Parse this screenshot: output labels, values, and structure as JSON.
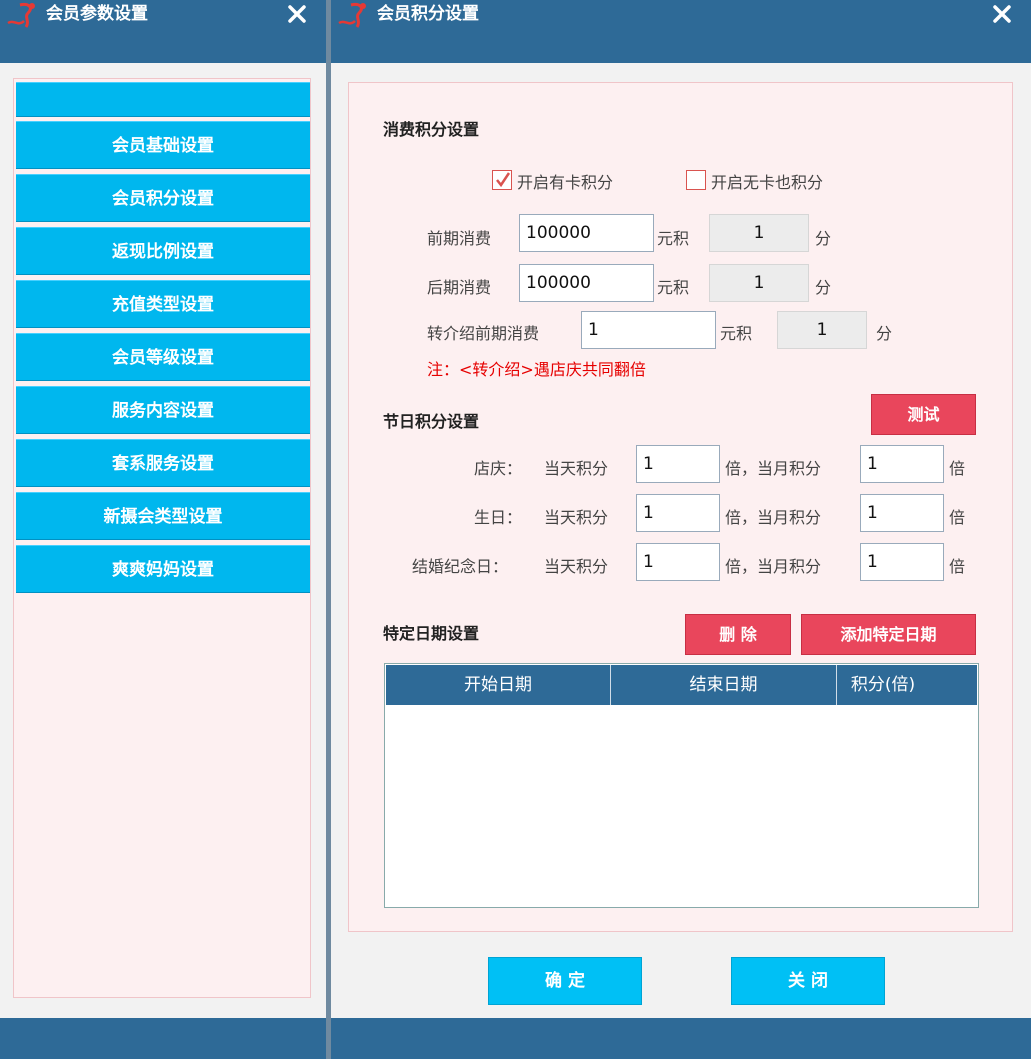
{
  "left_window": {
    "title": "会员参数设置",
    "nav_items": [
      {
        "label": ""
      },
      {
        "label": "会员基础设置"
      },
      {
        "label": "会员积分设置"
      },
      {
        "label": "返现比例设置"
      },
      {
        "label": "充值类型设置"
      },
      {
        "label": "会员等级设置"
      },
      {
        "label": "服务内容设置"
      },
      {
        "label": "套系服务设置"
      },
      {
        "label": "新摄会类型设置"
      },
      {
        "label": "爽爽妈妈设置"
      }
    ]
  },
  "right_window": {
    "title": "会员积分设置",
    "consume": {
      "section_title": "消费积分设置",
      "card_points_label": "开启有卡积分",
      "card_points_checked": true,
      "nocard_points_label": "开启无卡也积分",
      "nocard_points_checked": false,
      "early_label": "前期消费",
      "early_amount": "100000",
      "yuan_ji": "元积",
      "early_points": "1",
      "fen": "分",
      "late_label": "后期消费",
      "late_amount": "100000",
      "late_points": "1",
      "referral_label": "转介绍前期消费",
      "referral_amount": "1",
      "referral_points": "1",
      "note": "注：<转介绍>遇店庆共同翻倍"
    },
    "holiday": {
      "section_title": "节日积分设置",
      "test_button": "测试",
      "rows": [
        {
          "label": "店庆：",
          "day_label": "当天积分",
          "day_value": "1",
          "month_label": "倍，当月积分",
          "month_value": "1",
          "unit": "倍"
        },
        {
          "label": "生日：",
          "day_label": "当天积分",
          "day_value": "1",
          "month_label": "倍，当月积分",
          "month_value": "1",
          "unit": "倍"
        },
        {
          "label": "结婚纪念日：",
          "day_label": "当天积分",
          "day_value": "1",
          "month_label": "倍，当月积分",
          "month_value": "1",
          "unit": "倍"
        }
      ]
    },
    "special": {
      "section_title": "特定日期设置",
      "delete_button": "删 除",
      "add_button": "添加特定日期",
      "columns": [
        "开始日期",
        "结束日期",
        "积分(倍)"
      ]
    },
    "footer": {
      "confirm_button": "确 定",
      "close_button": "关 闭"
    }
  },
  "colors": {
    "titlebar": "#2e6a97",
    "nav_button": "#00b7ee",
    "red_button": "#e9465c",
    "panel_bg": "#fdf0f1"
  }
}
